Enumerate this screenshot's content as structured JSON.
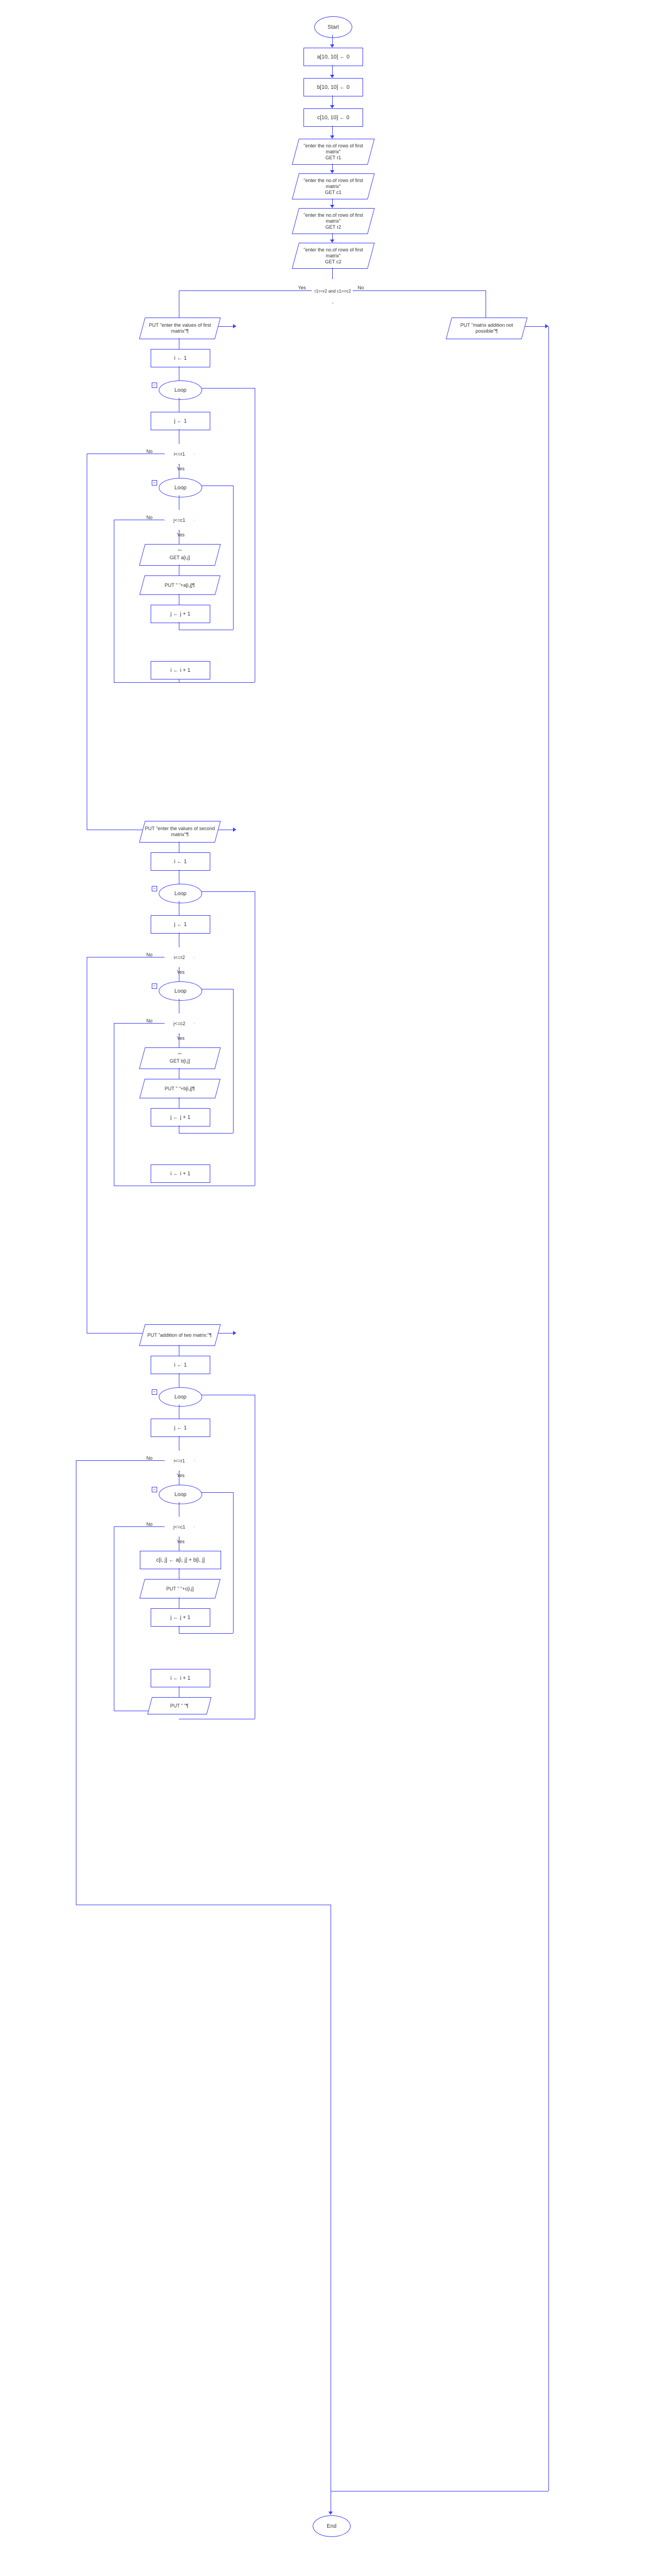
{
  "chart_data": {
    "type": "flowchart",
    "title": "Matrix Addition Algorithm",
    "nodes": [
      {
        "id": "start",
        "type": "terminal",
        "label": "Start"
      },
      {
        "id": "n1",
        "type": "process",
        "label": "a[10, 10] ← 0"
      },
      {
        "id": "n2",
        "type": "process",
        "label": "b[10, 10] ← 0"
      },
      {
        "id": "n3",
        "type": "process",
        "label": "c[10, 10] ← 0"
      },
      {
        "id": "n4",
        "type": "io",
        "label": "\"enter the no.of rows of first matrix\"\nGET r1"
      },
      {
        "id": "n5",
        "type": "io",
        "label": "\"enter the no.of rows of first matrix\"\nGET c1"
      },
      {
        "id": "n6",
        "type": "io",
        "label": "\"enter the no.of rows of first matrix\"\nGET r2"
      },
      {
        "id": "n7",
        "type": "io",
        "label": "\"enter the no.of rows of first matrix\"\nGET c2"
      },
      {
        "id": "d1",
        "type": "decision",
        "label": "r1==r2 and c1==c2",
        "yes": "n8",
        "no": "n_else"
      },
      {
        "id": "n_else",
        "type": "io",
        "label": "PUT \"matrix addition not possible\"¶"
      },
      {
        "id": "n8",
        "type": "io",
        "label": "PUT \"enter the values of first matrix\"¶"
      },
      {
        "id": "n9",
        "type": "process",
        "label": "i ← 1"
      },
      {
        "id": "l1",
        "type": "loop",
        "label": "Loop"
      },
      {
        "id": "n10",
        "type": "process",
        "label": "j ← 1"
      },
      {
        "id": "d2",
        "type": "decision",
        "label": "i<=r1"
      },
      {
        "id": "l2",
        "type": "loop",
        "label": "Loop"
      },
      {
        "id": "d3",
        "type": "decision",
        "label": "j<=c1"
      },
      {
        "id": "n11",
        "type": "io",
        "label": "\"\"\nGET a[i,j]"
      },
      {
        "id": "n12",
        "type": "io",
        "label": "PUT \" \"+a[i,j]¶"
      },
      {
        "id": "n13",
        "type": "process",
        "label": "j ← j + 1"
      },
      {
        "id": "n14",
        "type": "process",
        "label": "i ← i + 1"
      },
      {
        "id": "n15",
        "type": "io",
        "label": "PUT \"enter the values of second matrix\"¶"
      },
      {
        "id": "n16",
        "type": "process",
        "label": "i ← 1"
      },
      {
        "id": "l3",
        "type": "loop",
        "label": "Loop"
      },
      {
        "id": "n17",
        "type": "process",
        "label": "j ← 1"
      },
      {
        "id": "d4",
        "type": "decision",
        "label": "i<=r2"
      },
      {
        "id": "l4",
        "type": "loop",
        "label": "Loop"
      },
      {
        "id": "d5",
        "type": "decision",
        "label": "j<=c2"
      },
      {
        "id": "n18",
        "type": "io",
        "label": "\"\"\nGET b[i,j]"
      },
      {
        "id": "n19",
        "type": "io",
        "label": "PUT \" \"+b[i,j]¶"
      },
      {
        "id": "n20",
        "type": "process",
        "label": "j ← j + 1"
      },
      {
        "id": "n21",
        "type": "process",
        "label": "i ← i + 1"
      },
      {
        "id": "n22",
        "type": "io",
        "label": "PUT \"addition of two matrix:\"¶"
      },
      {
        "id": "n23",
        "type": "process",
        "label": "i ← 1"
      },
      {
        "id": "l5",
        "type": "loop",
        "label": "Loop"
      },
      {
        "id": "n24",
        "type": "process",
        "label": "j ← 1"
      },
      {
        "id": "d6",
        "type": "decision",
        "label": "i<=r1"
      },
      {
        "id": "l6",
        "type": "loop",
        "label": "Loop"
      },
      {
        "id": "d7",
        "type": "decision",
        "label": "j<=c1"
      },
      {
        "id": "n25",
        "type": "process",
        "label": "c[i, j] ← a[i, j] + b[i, j]"
      },
      {
        "id": "n26",
        "type": "io",
        "label": "PUT \" \"+c[i,j]"
      },
      {
        "id": "n27",
        "type": "process",
        "label": "j ← j + 1"
      },
      {
        "id": "n28",
        "type": "process",
        "label": "i ← i + 1"
      },
      {
        "id": "n29",
        "type": "io",
        "label": "PUT \" \"¶"
      },
      {
        "id": "end",
        "type": "terminal",
        "label": "End"
      }
    ]
  },
  "t": {
    "start": "Start",
    "end": "End",
    "a0": "a[10, 10] ← 0",
    "b0": "b[10, 10] ← 0",
    "c0": "c[10, 10] ← 0",
    "r1": "\"enter the no.of rows of first matrix\"",
    "gr1": "GET r1",
    "gc1": "GET c1",
    "gr2": "GET r2",
    "gc2": "GET c2",
    "cond": "r1==r2 and c1==c2",
    "else": "PUT \"matrix addition not possible\"¶",
    "ev1": "PUT \"enter the values of first matrix\"¶",
    "ev2": "PUT \"enter the values of second matrix\"¶",
    "addt": "PUT \"addition of two matrix:\"¶",
    "i1": "i ← 1",
    "j1": "j ← 1",
    "loop": "Loop",
    "ir1": "i<=r1",
    "jc1": "j<=c1",
    "ir2": "i<=r2",
    "jc2": "j<=c2",
    "ga": "GET a[i,j]",
    "gb": "GET b[i,j]",
    "dd": "\"\"",
    "pa": "PUT \" \"+a[i,j]¶",
    "pb": "PUT \" \"+b[i,j]¶",
    "pc": "PUT \" \"+c[i,j]",
    "jj": "j ← j + 1",
    "ii": "i ← i + 1",
    "cij": "c[i, j] ← a[i, j] + b[i, j]",
    "pnl": "PUT \" \"¶",
    "yes": "Yes",
    "no": "No"
  }
}
